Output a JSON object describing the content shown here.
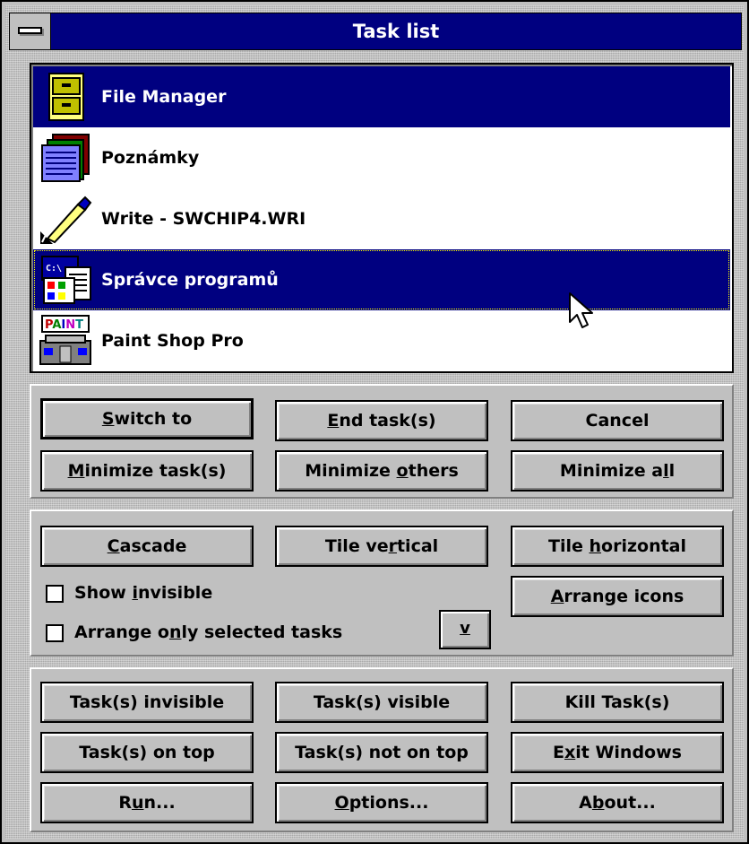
{
  "window": {
    "title": "Task list"
  },
  "tasks": [
    {
      "label": "File Manager",
      "icon": "file-manager-icon",
      "selected": true
    },
    {
      "label": "Poznámky",
      "icon": "notepad-icon",
      "selected": false
    },
    {
      "label": "Write - SWCHIP4.WRI",
      "icon": "write-pen-icon",
      "selected": false
    },
    {
      "label": "Správce programů",
      "icon": "program-manager-icon",
      "selected": true
    },
    {
      "label": "Paint Shop Pro",
      "icon": "paint-shop-pro-icon",
      "selected": false
    }
  ],
  "task_buttons": {
    "switch_to": {
      "pre": "",
      "key": "S",
      "post": "witch to"
    },
    "end_tasks": {
      "pre": "",
      "key": "E",
      "post": "nd task(s)"
    },
    "cancel": "Cancel",
    "minimize_tasks": {
      "pre": "",
      "key": "M",
      "post": "inimize task(s)"
    },
    "minimize_others": {
      "pre": "Minimize ",
      "key": "o",
      "post": "thers"
    },
    "minimize_all": {
      "pre": "Minimize a",
      "key": "l",
      "post": "l"
    }
  },
  "arrange": {
    "cascade": {
      "pre": "",
      "key": "C",
      "post": "ascade"
    },
    "tile_vertical": {
      "pre": "Tile ve",
      "key": "r",
      "post": "tical"
    },
    "tile_horizontal": {
      "pre": "Tile ",
      "key": "h",
      "post": "orizontal"
    },
    "arrange_icons": {
      "pre": "",
      "key": "A",
      "post": "rrange icons"
    },
    "show_invisible": {
      "pre": "Show ",
      "key": "i",
      "post": "nvisible",
      "checked": false
    },
    "arrange_only_selected": {
      "pre": "Arrange o",
      "key": "n",
      "post": "ly selected tasks",
      "checked": false
    },
    "more_button": "v"
  },
  "extra_buttons": {
    "tasks_invisible": "Task(s) invisible",
    "tasks_visible": "Task(s) visible",
    "kill_tasks": "Kill Task(s)",
    "tasks_on_top": "Task(s) on top",
    "tasks_not_on_top": "Task(s) not on top",
    "exit_windows": {
      "pre": "E",
      "key": "x",
      "post": "it Windows"
    },
    "run": {
      "pre": "R",
      "key": "u",
      "post": "n..."
    },
    "options": {
      "pre": "",
      "key": "O",
      "post": "ptions..."
    },
    "about": {
      "pre": "A",
      "key": "b",
      "post": "out..."
    }
  },
  "colors": {
    "selection": "#000080",
    "face": "#c0c0c0",
    "titlebar": "#000080"
  }
}
